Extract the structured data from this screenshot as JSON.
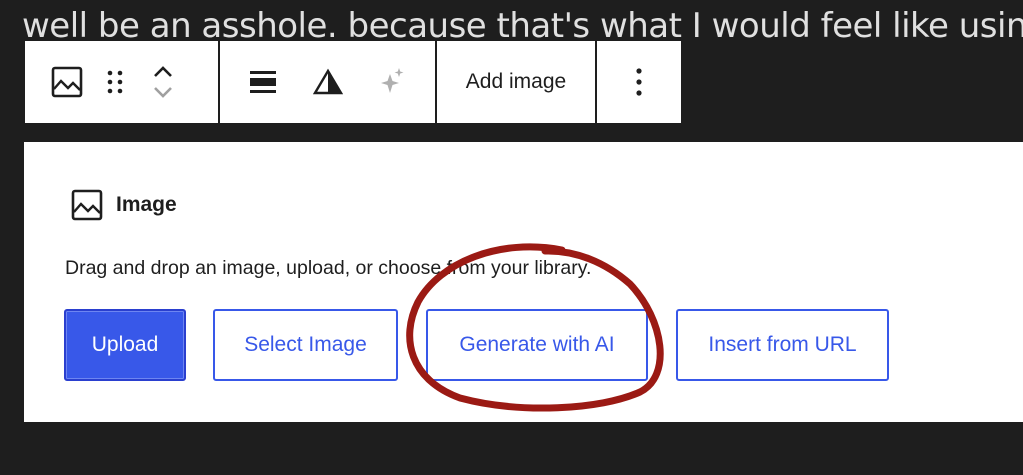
{
  "background_text": "well be an asshole. because that's what I would feel like using",
  "toolbar": {
    "icons": [
      "image-icon",
      "drag-handle-icon",
      "chevron-up-icon",
      "chevron-down-icon",
      "align-wide-icon",
      "contrast-icon",
      "sparkles-icon",
      "more-options-icon"
    ],
    "add_image_label": "Add image"
  },
  "block": {
    "title": "Image",
    "description": "Drag and drop an image, upload, or choose from your library.",
    "buttons": {
      "upload": "Upload",
      "select_image": "Select Image",
      "generate_ai": "Generate with AI",
      "insert_url": "Insert from URL"
    }
  },
  "colors": {
    "accent": "#3858e9",
    "annotation": "#9b1a14",
    "background": "#1e1e1e"
  }
}
